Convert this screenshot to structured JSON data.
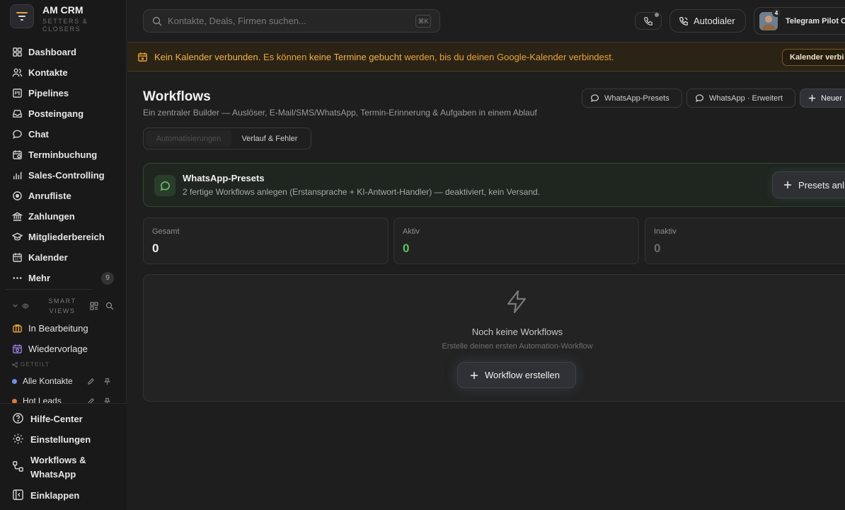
{
  "app": {
    "title": "AM CRM",
    "subtitle": "SETTERS & CLOSERS"
  },
  "sidebar": {
    "items": [
      {
        "label": "Dashboard",
        "icon": "dashboard-icon"
      },
      {
        "label": "Kontakte",
        "icon": "users-icon"
      },
      {
        "label": "Pipelines",
        "icon": "kanban-icon"
      },
      {
        "label": "Posteingang",
        "icon": "inbox-icon"
      },
      {
        "label": "Chat",
        "icon": "chat-bubble-icon"
      },
      {
        "label": "Terminbuchung",
        "icon": "calendar-clock-icon"
      },
      {
        "label": "Sales-Controlling",
        "icon": "bar-chart-icon"
      },
      {
        "label": "Anrufliste",
        "icon": "target-icon"
      },
      {
        "label": "Zahlungen",
        "icon": "bank-icon"
      },
      {
        "label": "Mitgliederbereich",
        "icon": "graduation-cap-icon"
      },
      {
        "label": "Kalender",
        "icon": "calendar-icon"
      },
      {
        "label": "Mehr",
        "icon": "more-dots-icon",
        "count": "9"
      }
    ],
    "smart_views": {
      "title": "SMART VIEWS",
      "items": [
        {
          "label": "In Bearbeitung",
          "icon": "briefcase-icon",
          "color": "#e9a23b"
        },
        {
          "label": "Wiedervorlage",
          "icon": "calendar-refresh-icon",
          "color": "#9b7be0"
        }
      ],
      "shared_label": "GETEILT",
      "shared_items": [
        {
          "label": "Alle Kontakte",
          "color": "#6f8fe6"
        },
        {
          "label": "Hot Leads",
          "color": "#e07a3a"
        }
      ]
    },
    "bottom": {
      "help": "Hilfe-Center",
      "settings": "Einstellungen",
      "workflows": "Workflows & WhatsApp",
      "collapse": "Einklappen"
    }
  },
  "topbar": {
    "search_placeholder": "Kontakte, Deals, Firmen suchen...",
    "search_shortcut": "⌘K",
    "autodialer": "Autodialer",
    "profile_name": "Telegram Pilot C",
    "profile_badge": "4"
  },
  "banner": {
    "strong1": "Kein Kalender verbunden.",
    "text1": " Es können ",
    "strong2": "keine Termine gebucht",
    "text2": " werden, bis du deinen Google-Kalender verbindest.",
    "cta": "Kalender verbi",
    "color": "#e9a23b"
  },
  "page": {
    "title": "Workflows",
    "description": "Ein zentraler Builder — Auslöser, E-Mail/SMS/WhatsApp, Termin-Erinnerung & Aufgaben in einem Ablauf",
    "buttons": {
      "presets": "WhatsApp-Presets",
      "advanced": "WhatsApp · Erweitert",
      "new": "Neuer"
    },
    "tabs": [
      "Automatisierungen",
      "Verlauf & Fehler"
    ]
  },
  "preset_card": {
    "title": "WhatsApp-Presets",
    "description": "2 fertige Workflows anlegen (Erstansprache + KI-Antwort-Handler) — deaktiviert, kein Versand.",
    "button": "Presets anl",
    "accent": "#5fbf62"
  },
  "stats": [
    {
      "label": "Gesamt",
      "value": "0"
    },
    {
      "label": "Aktiv",
      "value": "0"
    },
    {
      "label": "Inaktiv",
      "value": "0"
    }
  ],
  "empty_state": {
    "title": "Noch keine Workflows",
    "subtitle": "Erstelle deinen ersten Automation-Workflow",
    "button": "Workflow erstellen"
  }
}
